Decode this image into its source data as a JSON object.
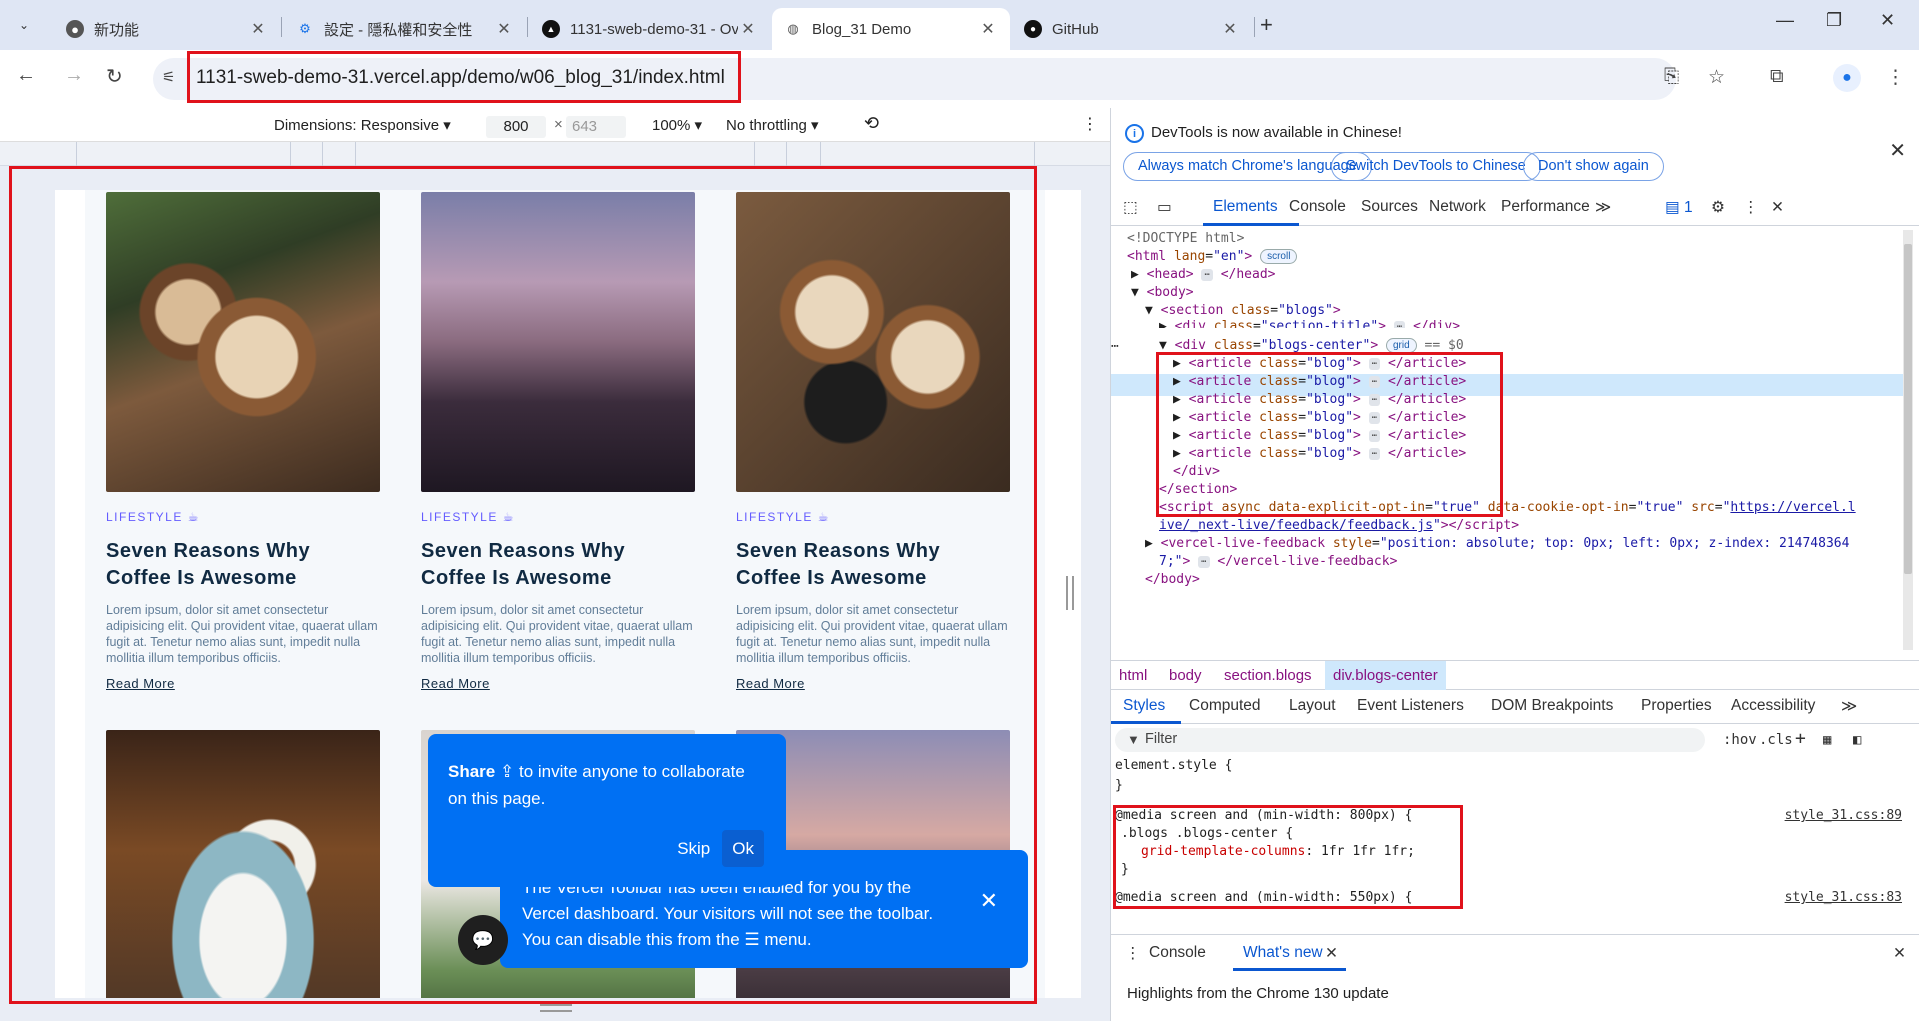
{
  "browser": {
    "tabs": [
      {
        "title": "新功能"
      },
      {
        "title": "設定 - 隱私權和安全性"
      },
      {
        "title": "1131-sweb-demo-31 - Overvi"
      },
      {
        "title": "Blog_31 Demo"
      },
      {
        "title": "GitHub"
      }
    ],
    "url": "1131-sweb-demo-31.vercel.app/demo/w06_blog_31/index.html"
  },
  "emulation": {
    "dimensions": "Dimensions: Responsive ▾",
    "width": "800",
    "height": "643",
    "zoom": "100% ▾",
    "throttling": "No throttling ▾"
  },
  "blog": {
    "cards": [
      {
        "category": "LIFESTYLE",
        "title": "Seven Reasons Why Coffee Is Awesome",
        "excerpt": "Lorem ipsum, dolor sit amet consectetur adipisicing elit. Qui provident vitae, quaerat ullam fugit at. Tenetur nemo alias sunt, impedit nulla mollitia illum temporibus officiis.",
        "link": "Read More"
      },
      {
        "category": "LIFESTYLE",
        "title": "Seven Reasons Why Coffee Is Awesome",
        "excerpt": "Lorem ipsum, dolor sit amet consectetur adipisicing elit. Qui provident vitae, quaerat ullam fugit at. Tenetur nemo alias sunt, impedit nulla mollitia illum temporibus officiis.",
        "link": "Read More"
      },
      {
        "category": "LIFESTYLE",
        "title": "Seven Reasons Why Coffee Is Awesome",
        "excerpt": "Lorem ipsum, dolor sit amet consectetur adipisicing elit. Qui provident vitae, quaerat ullam fugit at. Tenetur nemo alias sunt, impedit nulla mollitia illum temporibus officiis.",
        "link": "Read More"
      }
    ]
  },
  "vercel": {
    "share_bold": "Share",
    "share_text": "to invite anyone to collaborate on this page.",
    "skip": "Skip",
    "ok": "Ok",
    "toolbar_text_1": "The Vercel Toolbar has been enabled for you by the",
    "toolbar_text_2": "Vercel dashboard. Your visitors will not see the toolbar.",
    "toolbar_text_3": "You can disable this from the ☰ menu."
  },
  "devtools": {
    "info": "DevTools is now available in Chinese!",
    "pills": [
      "Always match Chrome's language",
      "Switch DevTools to Chinese",
      "Don't show again"
    ],
    "tabs": [
      "Elements",
      "Console",
      "Sources",
      "Network",
      "Performance"
    ],
    "issues_count": "1",
    "breadcrumbs": [
      "html",
      "body",
      "section.blogs",
      "div.blogs-center"
    ],
    "style_tabs": [
      "Styles",
      "Computed",
      "Layout",
      "Event Listeners",
      "DOM Breakpoints",
      "Properties",
      "Accessibility"
    ],
    "filter_placeholder": "Filter",
    "hov": ":hov",
    "cls": ".cls",
    "css": {
      "element_style": "element.style {",
      "close": "}",
      "media1": "@media screen and (min-width: 800px) {",
      "rule1_sel": ".blogs .blogs-center {",
      "rule1_prop": "grid-template-columns",
      "rule1_val": "1fr 1fr 1fr;",
      "src1": "style_31.css:89",
      "media2": "@media screen and (min-width: 550px) {",
      "src2": "style_31.css:83"
    },
    "drawer_tabs": [
      "Console",
      "What's new"
    ],
    "highlights": "Highlights from the Chrome 130 update"
  },
  "colors": {
    "accent": "#0b57d0",
    "highlight_border": "#e0121b",
    "vercel_blue": "#0070f3",
    "blog_purple": "#645cff"
  }
}
